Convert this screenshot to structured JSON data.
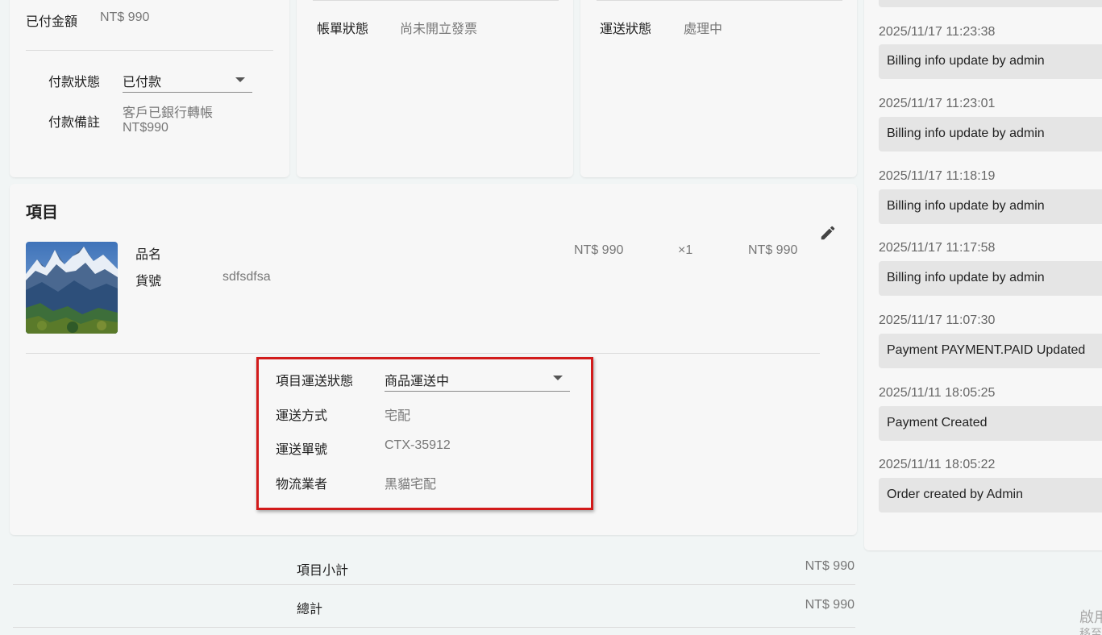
{
  "payment": {
    "paid_amount_label": "已付金額",
    "paid_amount_value": "NT$ 990",
    "status_label": "付款狀態",
    "status_value": "已付款",
    "note_label": "付款備註",
    "note_line1": "客戶已銀行轉帳",
    "note_line2": "NT$990"
  },
  "billing": {
    "status_label": "帳單狀態",
    "status_value": "尚未開立發票"
  },
  "shipping": {
    "status_label": "運送狀態",
    "status_value": "處理中"
  },
  "items": {
    "title": "項目",
    "item": {
      "name_label": "品名",
      "sku_label": "貨號",
      "sku_value": "sdfsdfsa",
      "unit_price": "NT$ 990",
      "quantity": "×1",
      "line_total": "NT$ 990",
      "image_icon": "mountain-landscape-image"
    },
    "shipment": {
      "status_label": "項目運送狀態",
      "status_value": "商品運送中",
      "method_label": "運送方式",
      "method_value": "宅配",
      "tracking_label": "運送單號",
      "tracking_value": "CTX-35912",
      "carrier_label": "物流業者",
      "carrier_value": "黑貓宅配"
    }
  },
  "totals": {
    "subtotal_label": "項目小計",
    "subtotal_value": "NT$ 990",
    "total_label": "總計",
    "total_value": "NT$ 990"
  },
  "activity_log": [
    {
      "time": "2025/11/17 11:23:38",
      "message": "Billing info update by admin"
    },
    {
      "time": "2025/11/17 11:23:01",
      "message": "Billing info update by admin"
    },
    {
      "time": "2025/11/17 11:18:19",
      "message": "Billing info update by admin"
    },
    {
      "time": "2025/11/17 11:17:58",
      "message": "Billing info update by admin"
    },
    {
      "time": "2025/11/17 11:07:30",
      "message": "Payment PAYMENT.PAID Updated"
    },
    {
      "time": "2025/11/11 18:05:25",
      "message": "Payment Created"
    },
    {
      "time": "2025/11/11 18:05:22",
      "message": "Order created by Admin"
    }
  ],
  "watermark": {
    "line1": "啟用",
    "line2": "移至"
  },
  "colors": {
    "highlight": "#d21b1b",
    "card_bg": "#f7f7f7",
    "page_bg": "#f1f5f5"
  },
  "icons": {
    "edit": "pencil-icon",
    "dropdown": "caret-down-icon"
  }
}
